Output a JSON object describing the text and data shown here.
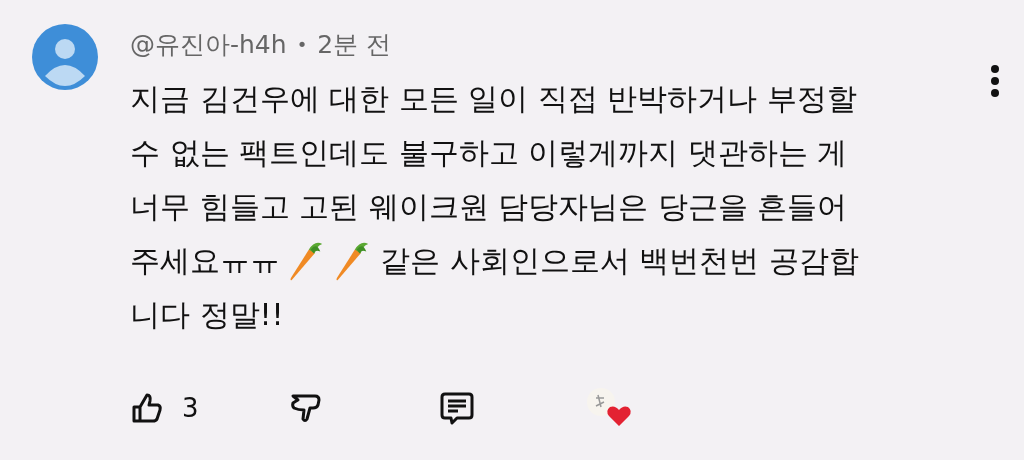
{
  "comment": {
    "author": "@유진아-h4h",
    "separator": "•",
    "time": "2분 전",
    "lines": [
      [
        {
          "kind": "text",
          "text": "지금 김건우에 대한 모든 일이 직접 반박하거나 부정할"
        }
      ],
      [
        {
          "kind": "text",
          "text": "수 없는 팩트인데도 불구하고 이렇게까지 댓관하는 게"
        }
      ],
      [
        {
          "kind": "text",
          "text": "너무 힘들고 고된 웨이크원 담당자님은 당근을 흔들어"
        }
      ],
      [
        {
          "kind": "text",
          "text": "주세요ㅠㅠ"
        },
        {
          "kind": "carrot"
        },
        {
          "kind": "carrot"
        },
        {
          "kind": "text",
          "text": "같은 사회인으로서 백번천번 공감합"
        }
      ],
      [
        {
          "kind": "text",
          "text": "니다 정말!!"
        }
      ]
    ],
    "like_count": "3",
    "creator_hearted": true
  }
}
